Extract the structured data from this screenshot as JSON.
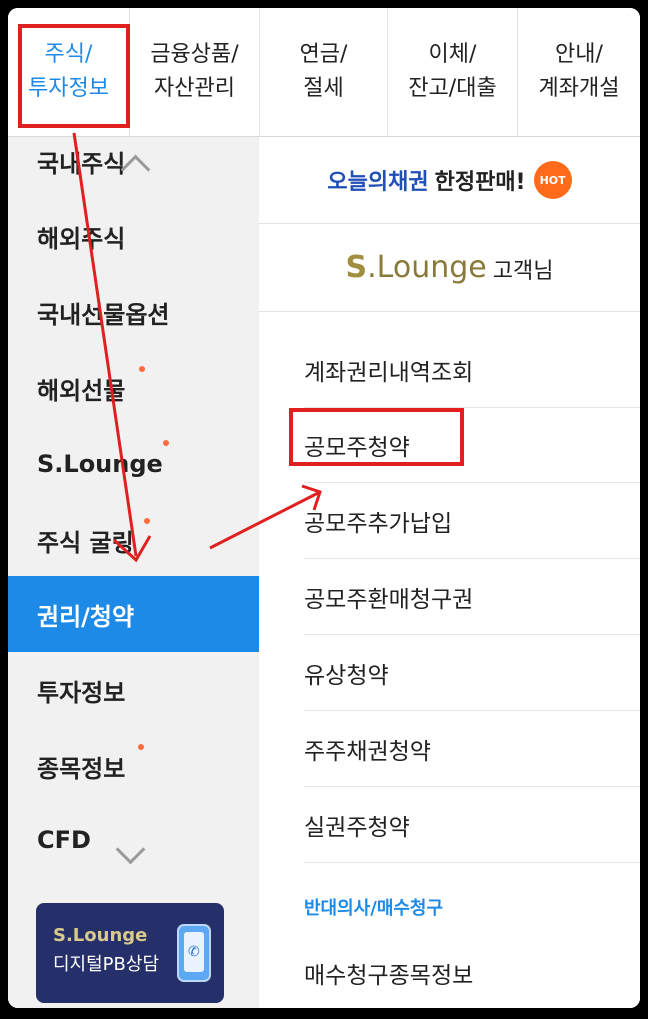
{
  "tabs": [
    {
      "line1": "주식/",
      "line2": "투자정보",
      "active": true
    },
    {
      "line1": "금융상품/",
      "line2": "자산관리",
      "active": false
    },
    {
      "line1": "연금/",
      "line2": "절세",
      "active": false
    },
    {
      "line1": "이체/",
      "line2": "잔고/대출",
      "active": false
    },
    {
      "line1": "안내/",
      "line2": "계좌개설",
      "active": false
    }
  ],
  "left_menu": {
    "items": [
      {
        "label": "국내주식"
      },
      {
        "label": "해외주식"
      },
      {
        "label": "국내선물옵션"
      },
      {
        "label": "해외선물"
      },
      {
        "label": "S.Lounge"
      },
      {
        "label": "주식 굴링"
      },
      {
        "label": "권리/청약"
      },
      {
        "label": "투자정보"
      },
      {
        "label": "종목정보"
      },
      {
        "label": "CFD"
      }
    ],
    "active_label": "권리/청약",
    "pb_banner": {
      "brand": "S.Lounge",
      "desc": "디지털PB상담"
    }
  },
  "right_panel": {
    "promo": {
      "highlight": "오늘의채권",
      "text": "한정판매!",
      "badge": "HOT"
    },
    "lounge": {
      "brand_s": "S",
      "brand_rest": ".Lounge",
      "suffix": "고객님"
    },
    "items": [
      {
        "label": "계좌권리내역조회"
      },
      {
        "label": "공모주청약"
      },
      {
        "label": "공모주추가납입"
      },
      {
        "label": "공모주환매청구권"
      },
      {
        "label": "유상청약"
      },
      {
        "label": "주주채권청약"
      },
      {
        "label": "실권주청약"
      }
    ],
    "section_title": "반대의사/매수청구",
    "section_items": [
      {
        "label": "매수청구종목정보"
      }
    ]
  },
  "annotation_color": "#e02020",
  "accent_color": "#1e8ae8"
}
